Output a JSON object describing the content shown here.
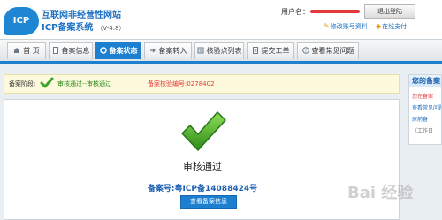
{
  "header": {
    "logo_text": "ICP",
    "brand_line1": "互联网非经营性网站",
    "brand_line2": "ICP备案系统",
    "version": "（V-4.8）",
    "user_label": "用户名：",
    "logout_label": "退出登陆",
    "edit_account_label": "修改账号资料",
    "online_pay_label": "在线支付"
  },
  "nav": {
    "tabs": [
      {
        "label": "首 页",
        "icon": "home-icon"
      },
      {
        "label": "备案信息",
        "icon": "document-icon"
      },
      {
        "label": "备案状态",
        "icon": "gear-icon",
        "active": true
      },
      {
        "label": "备案转入",
        "icon": "arrow-icon"
      },
      {
        "label": "核验点列表",
        "icon": "list-icon"
      },
      {
        "label": "提交工单",
        "icon": "form-icon"
      },
      {
        "label": "查看常见问题",
        "icon": "help-icon"
      }
    ]
  },
  "stage": {
    "label": "备案阶段:",
    "status": "审核通过--审核通过",
    "verify_number": "备案核验编号:0278402"
  },
  "main": {
    "title": "审核通过",
    "record_number": "备案号:粤ICP备14088424号",
    "view_button_label": "查看备案信息"
  },
  "sidebar": {
    "title": "您的备案",
    "items": [
      "您在备案",
      "查看常见问题",
      "原前备",
      "（工作日"
    ]
  },
  "watermark": "Bai 经验",
  "colors": {
    "accent": "#1d7fd0",
    "success": "#2a8a1a",
    "alert": "#e2393a"
  }
}
